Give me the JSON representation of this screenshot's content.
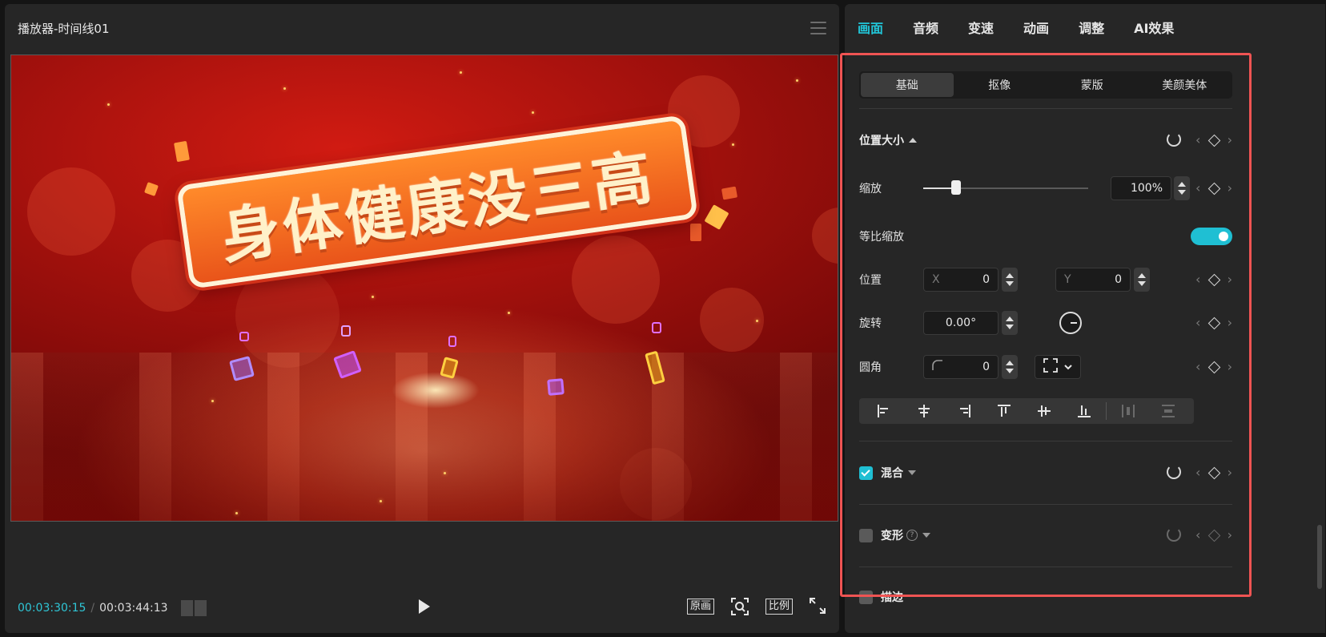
{
  "player": {
    "title": "播放器-时间线01",
    "video_text": "身体健康没三高",
    "time_current": "00:03:30:15",
    "time_sep": "/",
    "time_total": "00:03:44:13",
    "btn_original": "原画",
    "btn_ratio": "比例"
  },
  "inspector": {
    "tabs": [
      "画面",
      "音频",
      "变速",
      "动画",
      "调整",
      "AI效果"
    ],
    "subtabs": [
      "基础",
      "抠像",
      "蒙版",
      "美颜美体"
    ],
    "position_size": {
      "title": "位置大小",
      "scale_label": "缩放",
      "scale_value": "100%",
      "scale_fraction": 0.2,
      "uniform_label": "等比缩放",
      "uniform_on": true,
      "position_label": "位置",
      "x_prefix": "X",
      "x_value": "0",
      "y_prefix": "Y",
      "y_value": "0",
      "rotation_label": "旋转",
      "rotation_value": "0.00°",
      "corner_label": "圆角",
      "corner_value": "0"
    },
    "blend": {
      "title": "混合",
      "checked": true
    },
    "transform": {
      "title": "变形",
      "checked": false
    },
    "stroke": {
      "title": "描边",
      "checked": false
    }
  },
  "colors": {
    "accent": "#21c6d9",
    "highlight_frame": "#ef5453"
  }
}
